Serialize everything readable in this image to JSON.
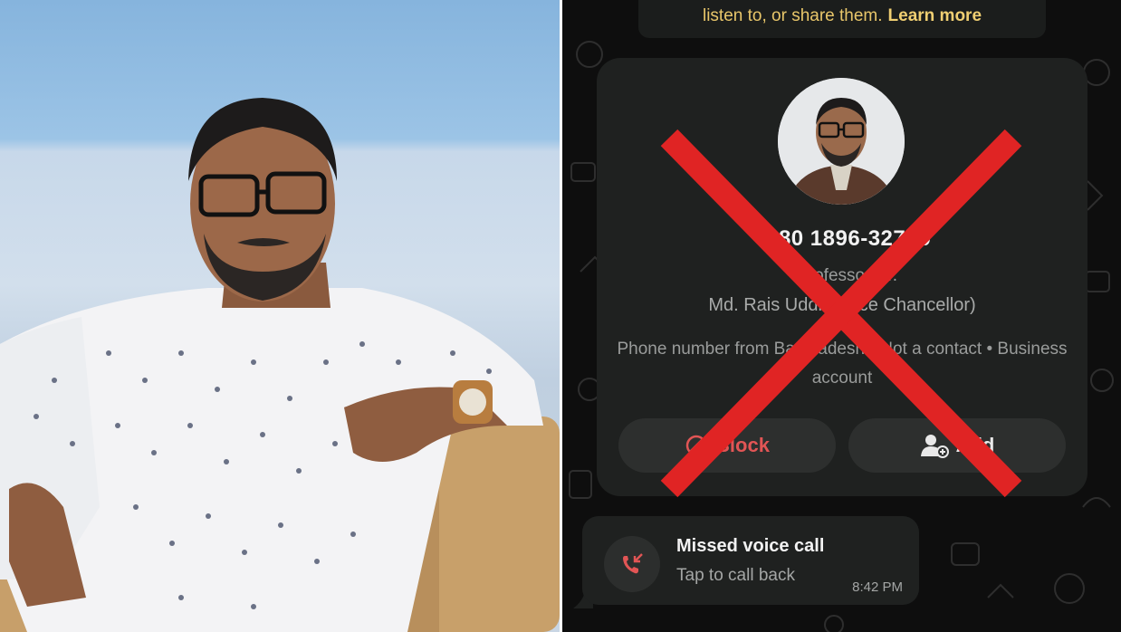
{
  "banner": {
    "text": "listen to, or share them.",
    "learn_more": "Learn more"
  },
  "contact": {
    "phone": "+880 1896-327  0",
    "about": "~Professor Dr.",
    "name": "Md. Rais Uddin (Vice Chancellor)",
    "meta": "Phone number from Bangladesh • Not a contact • Business account"
  },
  "actions": {
    "block_label": "Block",
    "add_label": "Add"
  },
  "missed_call": {
    "title": "Missed voice call",
    "subtitle": "Tap to call back",
    "time": "8:42 PM"
  },
  "colors": {
    "accent_red": "#e02424",
    "banner_text": "#e8c66a",
    "block_red": "#e25555"
  },
  "icons": {
    "block": "block-icon",
    "add_contact": "add-contact-icon",
    "missed_call": "missed-call-icon"
  }
}
